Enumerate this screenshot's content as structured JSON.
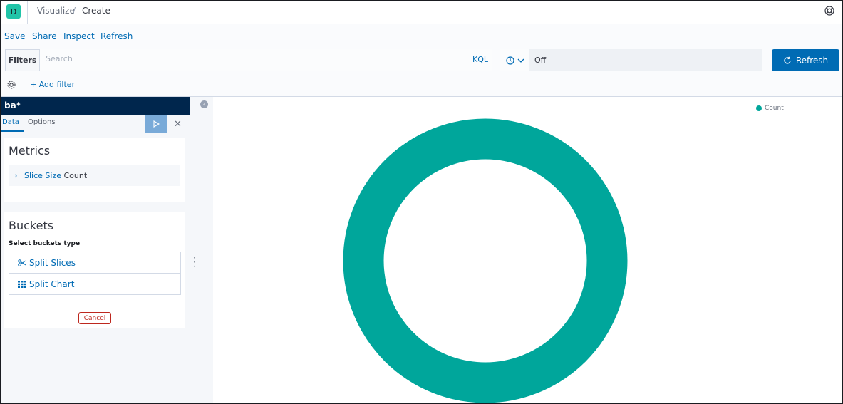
{
  "header": {
    "logo_letter": "D",
    "breadcrumbs": [
      "Visualize",
      "Create"
    ],
    "separator": "/",
    "help_icon": "help-icon"
  },
  "topnav": {
    "links": [
      "Save",
      "Share",
      "Inspect",
      "Refresh"
    ],
    "filters_label": "Filters",
    "search_placeholder": "Search",
    "query_language": "KQL",
    "time_value": "Off",
    "refresh_label": "Refresh",
    "add_filter_label": "+ Add filter"
  },
  "sidebar": {
    "index_pattern": "ba*",
    "tabs": [
      "Data",
      "Options"
    ],
    "metrics": {
      "title": "Metrics",
      "item_link": "Slice Size",
      "item_value": "Count"
    },
    "buckets": {
      "title": "Buckets",
      "subtitle": "Select buckets type",
      "options": [
        "Split Slices",
        "Split Chart"
      ],
      "cancel_label": "Cancel"
    }
  },
  "chart_data": {
    "type": "pie",
    "donut": true,
    "series": [
      {
        "name": "Count",
        "values": [
          1
        ]
      }
    ],
    "categories": [
      "Count"
    ],
    "legend": "top-right",
    "colors": [
      "#00a69b"
    ]
  },
  "colors": {
    "accent": "#006bb4",
    "header_dark": "#00264d",
    "donut": "#00a69b",
    "danger": "#bd271e"
  }
}
